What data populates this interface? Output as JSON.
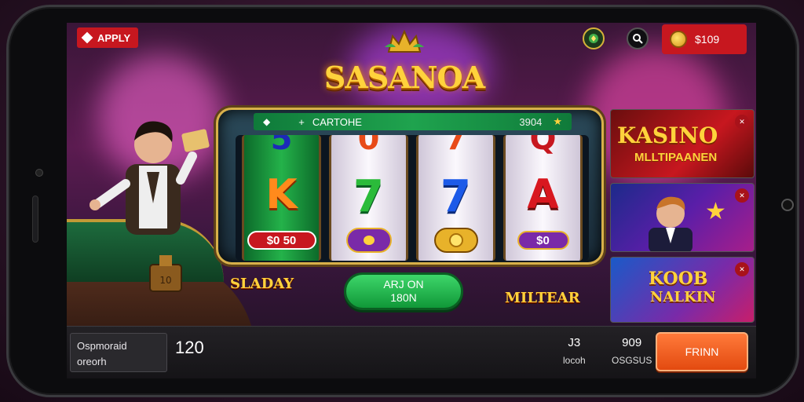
{
  "top_bar": {
    "app_label": "APPLY",
    "search_icon": "search-icon",
    "emblem_icon": "emblem-icon",
    "balance": "$109"
  },
  "title": "SASANOA",
  "machine": {
    "header_title": "CARTOHE",
    "header_value": "3904",
    "reels": [
      {
        "top": "5",
        "main": "K",
        "bet": "$0 50"
      },
      {
        "top": "0",
        "main": "7",
        "bet": ""
      },
      {
        "top": "7",
        "main": "7",
        "bet": ""
      },
      {
        "top": "Q",
        "main": "A",
        "bet": "$0"
      }
    ]
  },
  "spin_button": {
    "line1": "ARJ ON",
    "line2": "180N"
  },
  "mini_logos": {
    "left": "SLADAY",
    "right": "MILTEAR"
  },
  "promos": [
    {
      "title": "KASINO",
      "subtitle": "MLLTIPAANEN"
    },
    {
      "title": "",
      "subtitle": ""
    },
    {
      "title": "KOOB",
      "subtitle": "NALKIN"
    }
  ],
  "bottom_bar": {
    "info_line1": "Ospmoraid",
    "info_line2": "oreorh",
    "amount": "120",
    "stat1_value": "J3",
    "stat1_label": "locoh",
    "stat2_value": "909",
    "stat2_label": "OSGSUS",
    "action_label": "FRINN"
  },
  "colors": {
    "accent_red": "#c7171f",
    "spin_green": "#1fa34e",
    "action_orange": "#ff7a3a",
    "gold": "#ffd23c"
  }
}
